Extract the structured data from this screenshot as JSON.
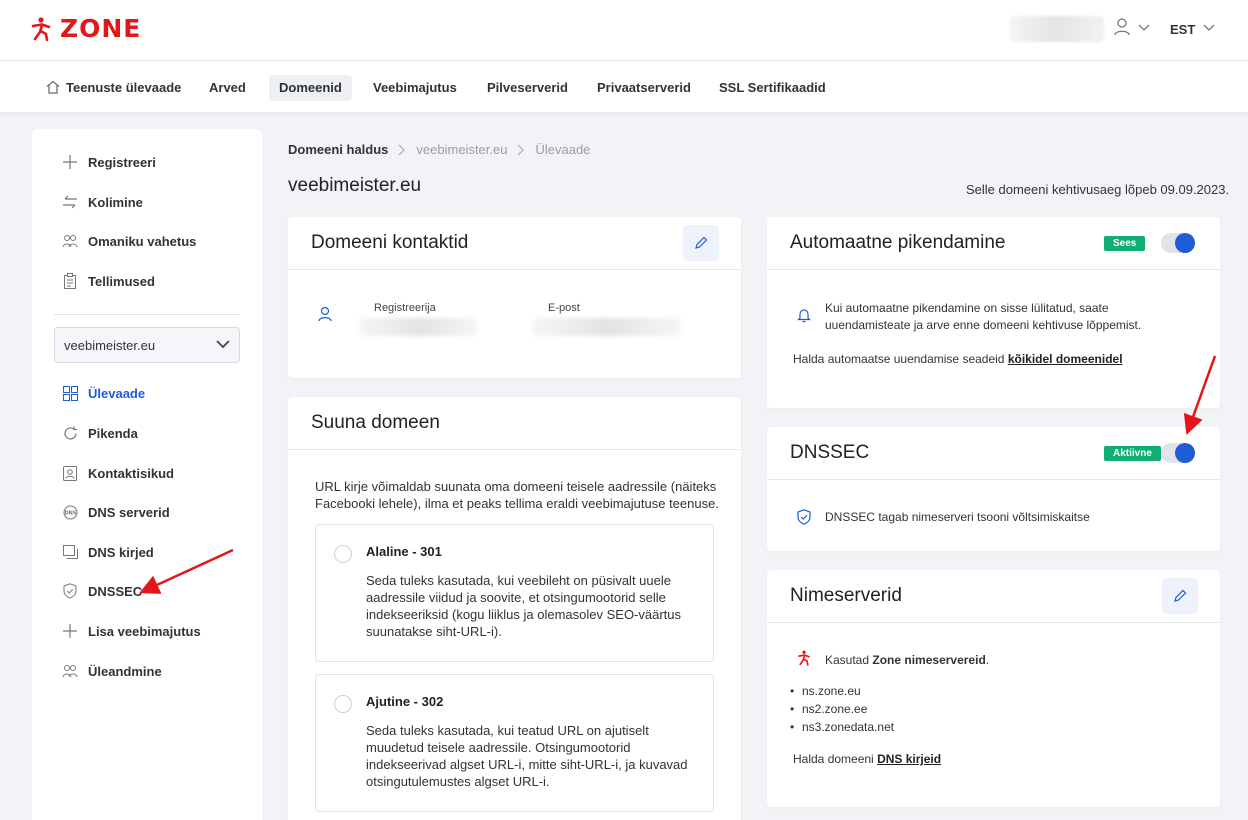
{
  "header": {
    "logo_text": "ZONE",
    "language": "EST"
  },
  "nav": {
    "items": [
      {
        "label": "Teenuste ülevaade"
      },
      {
        "label": "Arved"
      },
      {
        "label": "Domeenid"
      },
      {
        "label": "Veebimajutus"
      },
      {
        "label": "Pilveserverid"
      },
      {
        "label": "Privaatserverid"
      },
      {
        "label": "SSL Sertifikaadid"
      }
    ],
    "active": "Domeenid"
  },
  "sidebar": {
    "top_items": [
      {
        "label": "Registreeri"
      },
      {
        "label": "Kolimine"
      },
      {
        "label": "Omaniku vahetus"
      },
      {
        "label": "Tellimused"
      }
    ],
    "domain_select": "veebimeister.eu",
    "domain_items": [
      {
        "label": "Ülevaade"
      },
      {
        "label": "Pikenda"
      },
      {
        "label": "Kontaktisikud"
      },
      {
        "label": "DNS serverid"
      },
      {
        "label": "DNS kirjed"
      },
      {
        "label": "DNSSEC"
      },
      {
        "label": "Lisa veebimajutus"
      },
      {
        "label": "Üleandmine"
      }
    ],
    "active": "Ülevaade"
  },
  "breadcrumb": {
    "items": [
      "Domeeni haldus",
      "veebimeister.eu",
      "Ülevaade"
    ]
  },
  "page": {
    "title": "veebimeister.eu",
    "expiry": "Selle domeeni kehtivusaeg lõpeb 09.09.2023."
  },
  "contacts": {
    "title": "Domeeni kontaktid",
    "col_registrant": "Registreerija",
    "col_email": "E-post"
  },
  "redirect": {
    "title": "Suuna domeen",
    "desc": "URL kirje võimaldab suunata oma domeeni teisele aadressile (näiteks Facebooki lehele), ilma et peaks tellima eraldi veebimajutuse teenuse.",
    "options": [
      {
        "title": "Alaline - 301",
        "desc": "Seda tuleks kasutada, kui veebileht on püsivalt uuele aadressile viidud ja soovite, et otsingumootorid selle indekseeriksid (kogu liiklus ja olemasolev SEO-väärtus suunatakse siht-URL-i)."
      },
      {
        "title": "Ajutine - 302",
        "desc": "Seda tuleks kasutada, kui teatud URL on ajutiselt muudetud teisele aadressile. Otsingumootorid indekseerivad algset URL-i, mitte siht-URL-i, ja kuvavad otsingutulemustes algset URL-i."
      }
    ]
  },
  "autorenew": {
    "title": "Automaatne pikendamine",
    "badge": "Sees",
    "enabled": true,
    "info": "Kui automaatne pikendamine on sisse lülitatud, saate uuendamisteate ja arve enne domeeni kehtivuse lõppemist.",
    "manage_prefix": "Halda automaatse uuendamise seadeid",
    "manage_link": "kõikidel domeenidel"
  },
  "dnssec": {
    "title": "DNSSEC",
    "badge": "Aktiivne",
    "enabled": true,
    "info": "DNSSEC tagab nimeserveri tsooni võltsimiskaitse"
  },
  "nameservers": {
    "title": "Nimeserverid",
    "using_prefix": "Kasutad",
    "using_strong": "Zone nimeservereid",
    "using_suffix": ".",
    "list": [
      "ns.zone.eu",
      "ns2.zone.ee",
      "ns3.zonedata.net"
    ],
    "manage_prefix": "Halda domeeni",
    "manage_link": "DNS kirjeid"
  },
  "colors": {
    "accent": "#1f5cd6",
    "brand": "#e3161a",
    "badge": "#0fae73",
    "arrow": "#e3161a"
  }
}
